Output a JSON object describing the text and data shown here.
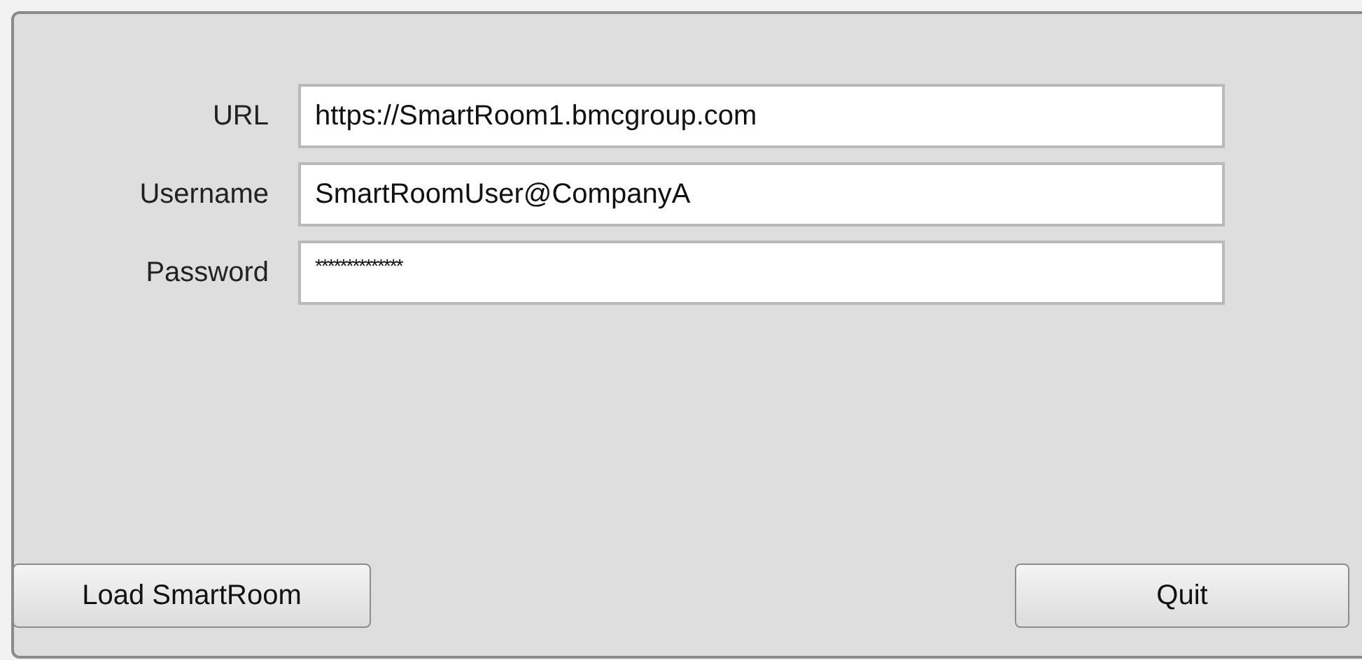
{
  "fields": [
    {
      "label": "URL",
      "value": "https://SmartRoom1.bmcgroup.com"
    },
    {
      "label": "Username",
      "value": "SmartRoomUser@CompanyA"
    },
    {
      "label": "Password",
      "value": "**************"
    }
  ],
  "buttons": [
    "Load SmartRoom",
    "Quit"
  ]
}
